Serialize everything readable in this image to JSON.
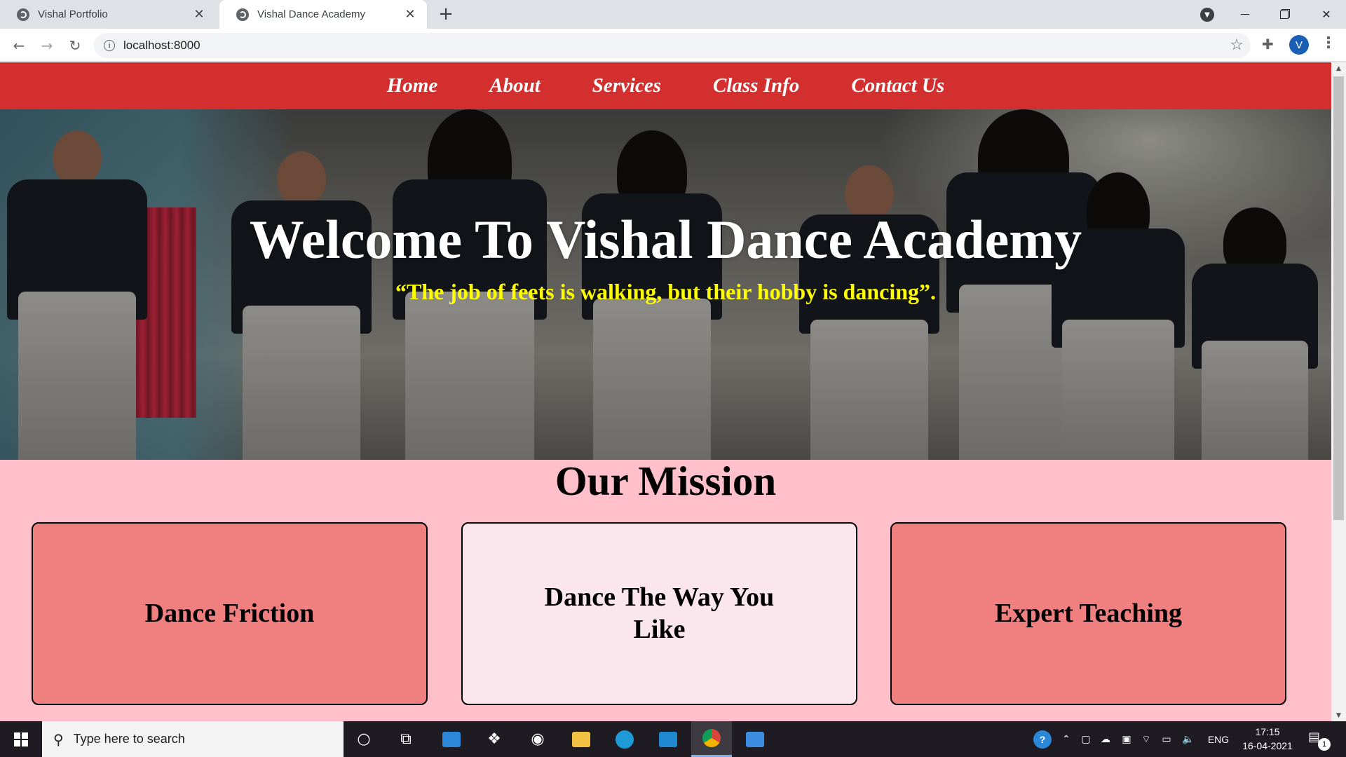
{
  "browser": {
    "tabs": [
      {
        "title": "Vishal Portfolio",
        "active": false
      },
      {
        "title": "Vishal Dance Academy",
        "active": true
      }
    ],
    "url": "localhost:8000",
    "profile_initial": "V"
  },
  "site": {
    "nav": [
      "Home",
      "About",
      "Services",
      "Class Info",
      "Contact Us"
    ],
    "hero": {
      "title": "Welcome To Vishal Dance Academy",
      "quote": "“The job of feets is walking, but their hobby is dancing”."
    },
    "mission": {
      "heading": "Our Mission",
      "cards": [
        "Dance Friction",
        "Dance The Way You Like",
        "Expert Teaching"
      ]
    },
    "colors": {
      "nav_bg": "#d32f2f",
      "page_bg": "#ffc0cb",
      "quote": "#ffff00",
      "card_accent": "#f08080",
      "card_light": "#fae6ec"
    }
  },
  "taskbar": {
    "search_placeholder": "Type here to search",
    "language": "ENG",
    "time": "17:15",
    "date": "16-04-2021",
    "notification_count": "1",
    "apps": [
      "cortana-icon",
      "task-view-icon",
      "mail-icon",
      "dropbox-icon",
      "github-desktop-icon",
      "file-explorer-icon",
      "edge-icon",
      "vscode-icon",
      "chrome-icon",
      "photos-icon"
    ]
  }
}
